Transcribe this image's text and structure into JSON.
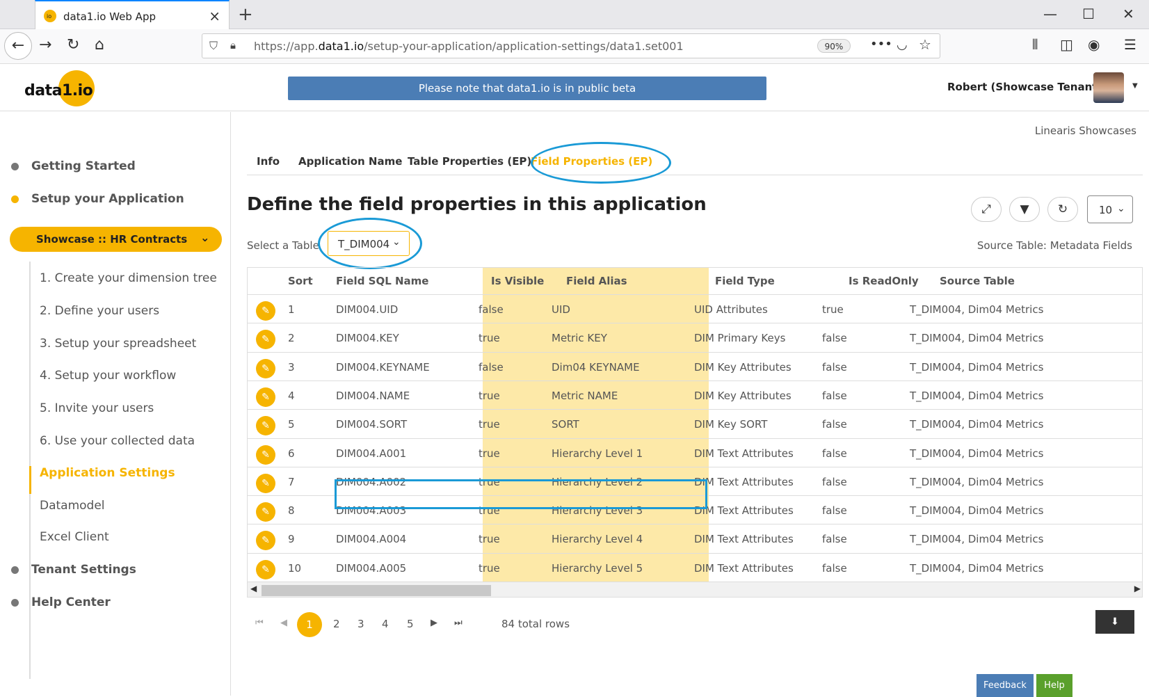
{
  "browser": {
    "tab_title": "data1.io Web App",
    "url_prefix": "https://app.",
    "url_domain": "data1.io",
    "url_path": "/setup-your-application/application-settings/data1.set001",
    "zoom": "90%"
  },
  "header": {
    "logo_text": "data1.io",
    "beta_notice": "Please note that data1.io is in public beta",
    "user_name": "Robert (Showcase Tenant)"
  },
  "sidebar": {
    "sections": [
      {
        "label": "Getting Started"
      },
      {
        "label": "Setup your Application"
      },
      {
        "label": "Tenant Settings"
      },
      {
        "label": "Help Center"
      }
    ],
    "app_select": "Showcase :: HR Contracts",
    "sub_items": [
      {
        "label": "1. Create your dimension tree"
      },
      {
        "label": "2. Define your users"
      },
      {
        "label": "3. Setup your spreadsheet"
      },
      {
        "label": "4. Setup your workflow"
      },
      {
        "label": "5. Invite your users"
      },
      {
        "label": "6. Use your collected data"
      },
      {
        "label": "Application Settings"
      },
      {
        "label": "Datamodel"
      },
      {
        "label": "Excel Client"
      }
    ]
  },
  "main": {
    "crumb": "Linearis Showcases",
    "tabs": [
      {
        "label": "Info"
      },
      {
        "label": "Application Name"
      },
      {
        "label": "Table Properties (EP)"
      },
      {
        "label": "Field Properties (EP)"
      }
    ],
    "heading": "Define the field properties in this application",
    "page_size": "10",
    "select_label": "Select a Table",
    "select_value": "T_DIM004",
    "source_label": "Source Table: Metadata Fields",
    "columns": [
      "Sort",
      "Field SQL Name",
      "Is Visible",
      "Field Alias",
      "Field Type",
      "Is ReadOnly",
      "Source Table"
    ],
    "rows": [
      {
        "sort": "1",
        "sql": "DIM004.UID",
        "visible": "false",
        "alias": "UID",
        "type": "UID Attributes",
        "readonly": "true",
        "source": "T_DIM004, Dim04 Metrics"
      },
      {
        "sort": "2",
        "sql": "DIM004.KEY",
        "visible": "true",
        "alias": "Metric KEY",
        "type": "DIM Primary Keys",
        "readonly": "false",
        "source": "T_DIM004, Dim04 Metrics"
      },
      {
        "sort": "3",
        "sql": "DIM004.KEYNAME",
        "visible": "false",
        "alias": "Dim04 KEYNAME",
        "type": "DIM Key Attributes",
        "readonly": "false",
        "source": "T_DIM004, Dim04 Metrics"
      },
      {
        "sort": "4",
        "sql": "DIM004.NAME",
        "visible": "true",
        "alias": "Metric NAME",
        "type": "DIM Key Attributes",
        "readonly": "false",
        "source": "T_DIM004, Dim04 Metrics"
      },
      {
        "sort": "5",
        "sql": "DIM004.SORT",
        "visible": "true",
        "alias": "SORT",
        "type": "DIM Key SORT",
        "readonly": "false",
        "source": "T_DIM004, Dim04 Metrics"
      },
      {
        "sort": "6",
        "sql": "DIM004.A001",
        "visible": "true",
        "alias": "Hierarchy Level 1",
        "type": "DIM Text Attributes",
        "readonly": "false",
        "source": "T_DIM004, Dim04 Metrics"
      },
      {
        "sort": "7",
        "sql": "DIM004.A002",
        "visible": "true",
        "alias": "Hierarchy Level 2",
        "type": "DIM Text Attributes",
        "readonly": "false",
        "source": "T_DIM004, Dim04 Metrics"
      },
      {
        "sort": "8",
        "sql": "DIM004.A003",
        "visible": "true",
        "alias": "Hierarchy Level 3",
        "type": "DIM Text Attributes",
        "readonly": "false",
        "source": "T_DIM004, Dim04 Metrics"
      },
      {
        "sort": "9",
        "sql": "DIM004.A004",
        "visible": "true",
        "alias": "Hierarchy Level 4",
        "type": "DIM Text Attributes",
        "readonly": "false",
        "source": "T_DIM004, Dim04 Metrics"
      },
      {
        "sort": "10",
        "sql": "DIM004.A005",
        "visible": "true",
        "alias": "Hierarchy Level 5",
        "type": "DIM Text Attributes",
        "readonly": "false",
        "source": "T_DIM004, Dim04 Metrics"
      }
    ],
    "pages": [
      "1",
      "2",
      "3",
      "4",
      "5"
    ],
    "total_rows": "84 total rows",
    "feedback_label": "Feedback",
    "help_label": "Help"
  },
  "colors": {
    "accent": "#f6b400",
    "banner": "#4b7db5",
    "annotation": "#1a9ad6",
    "highlight_column": "#fde9a8"
  }
}
